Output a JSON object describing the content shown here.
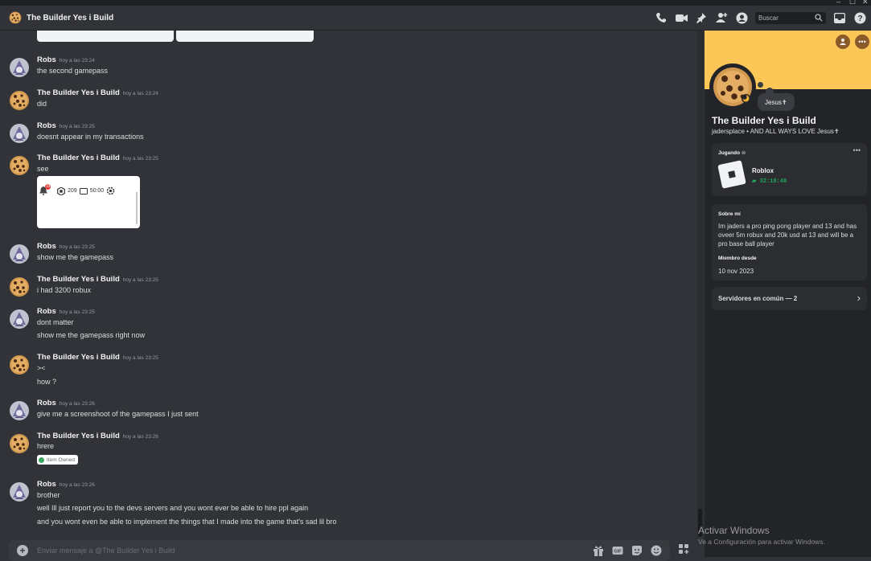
{
  "header": {
    "title": "The Builder Yes i Build",
    "search_placeholder": "Buscar"
  },
  "users": {
    "robs": "Robs",
    "builder": "The Builder Yes i Build"
  },
  "messages": [
    {
      "author": "Robs",
      "time": "hoy a las 23:24",
      "lines": [
        "the second gamepass"
      ]
    },
    {
      "author": "The Builder Yes i Build",
      "time": "hoy a las 23:24",
      "lines": [
        "did"
      ]
    },
    {
      "author": "Robs",
      "time": "hoy a las 23:25",
      "lines": [
        "doesnt appear in my transactions"
      ]
    },
    {
      "author": "The Builder Yes i Build",
      "time": "hoy a las 23:25",
      "lines": [
        "see"
      ]
    },
    {
      "author": "Robs",
      "time": "hoy a las 23:25",
      "lines": [
        "show me the gamepass"
      ]
    },
    {
      "author": "The Builder Yes i Build",
      "time": "hoy a las 23:25",
      "lines": [
        "i had 3200 robux"
      ]
    },
    {
      "author": "Robs",
      "time": "hoy a las 23:25",
      "lines": [
        "dont matter",
        "show me the gamepass right now"
      ]
    },
    {
      "author": "The Builder Yes i Build",
      "time": "hoy a las 23:25",
      "lines": [
        ">< ",
        "how ?"
      ]
    },
    {
      "author": "Robs",
      "time": "hoy a las 23:26",
      "lines": [
        "give me a screenshoot of the gamepass I just sent"
      ]
    },
    {
      "author": "The Builder Yes i Build",
      "time": "hoy a las 23:26",
      "lines": [
        "hrere"
      ]
    },
    {
      "author": "Robs",
      "time": "hoy a las 23:26",
      "lines": [
        "brother",
        "well Ill just report you to the devs servers and you wont ever be able to hire ppl again",
        "and you wont even be able to implement the things that I made into the game that's sad lil bro"
      ]
    }
  ],
  "attachment": {
    "badge": "19",
    "robux": "209",
    "time": "50:00"
  },
  "owned_tag": "Item Owned",
  "composer": {
    "placeholder": "Enviar mensaje a @The Builder Yes i Build",
    "gif": "GIF"
  },
  "profile": {
    "name": "The Builder Yes i Build",
    "username_line": "jadersplace • AND ALL WAYS LOVE Jesus✝",
    "status_bubble": "Jesus✝",
    "activity_header": "Jugando",
    "game": "Roblox",
    "elapsed": "32:18:48",
    "about_header": "Sobre mí",
    "about_text": "Im jaders a pro ping pong player and 13 and has oveer 5m robux and 20k usd at 13 and will be a pro base ball player",
    "member_header": "Miembro desde",
    "member_since": "10 nov 2023",
    "mutual": "Servidores en común — 2",
    "banner_color": "#fcc757"
  },
  "watermark": {
    "title": "Activar Windows",
    "subtitle": "Ve a Configuración para activar Windows."
  },
  "colors": {
    "chat_bg": "#313338",
    "panel_bg": "#232428",
    "accent_green": "#23a559"
  }
}
